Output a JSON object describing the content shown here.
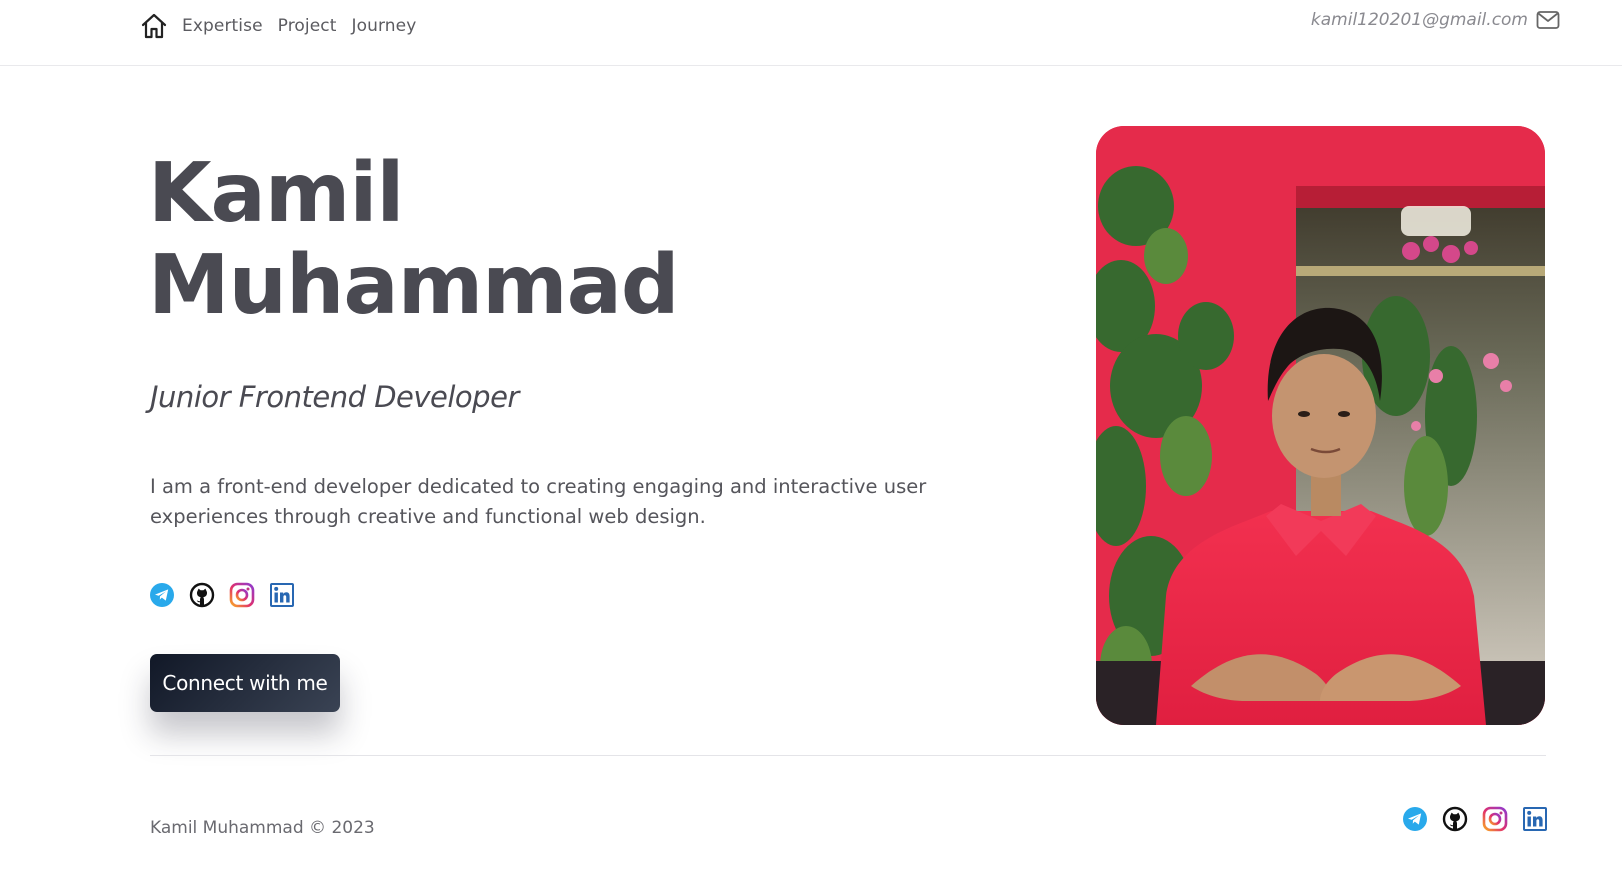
{
  "nav": {
    "links": [
      "Expertise",
      "Project",
      "Journey"
    ],
    "email": "kamil120201@gmail.com"
  },
  "hero": {
    "name_line1": "Kamil",
    "name_line2": "Muhammad",
    "role": "Junior Frontend Developer",
    "description": "I am a front-end developer dedicated to creating engaging and interactive user experiences through creative and functional web design.",
    "cta_label": "Connect with me"
  },
  "socials": [
    {
      "icon": "telegram-icon",
      "color": "#29a9eb"
    },
    {
      "icon": "github-icon",
      "color": "#111111"
    },
    {
      "icon": "instagram-icon",
      "color": "#e1306c"
    },
    {
      "icon": "linkedin-icon",
      "color": "#2867b2"
    }
  ],
  "footer": {
    "copyright": "Kamil Muhammad © 2023"
  },
  "colors": {
    "heading": "#4a4a52",
    "button_start": "#111827",
    "button_end": "#3a4354",
    "photo_bg": "#e2304d"
  }
}
